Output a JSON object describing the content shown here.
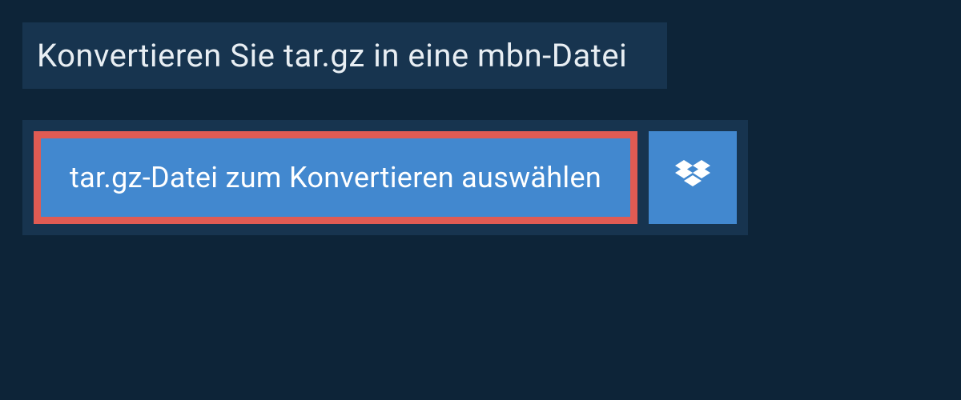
{
  "header": {
    "title": "Konvertieren Sie tar.gz in eine mbn-Datei"
  },
  "actions": {
    "select_file_label": "tar.gz-Datei zum Konvertieren auswählen"
  },
  "colors": {
    "background_dark": "#0d2438",
    "panel": "#17344f",
    "button_blue": "#4288cf",
    "highlight_border": "#e05b53",
    "text_light": "#e8eef3",
    "text_white": "#ffffff"
  }
}
